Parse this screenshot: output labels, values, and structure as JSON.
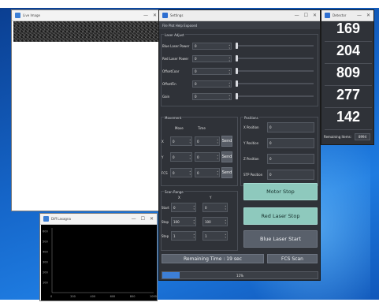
{
  "camera_window": {
    "title": "Live Image",
    "minimize": "—",
    "close": "✕"
  },
  "main_window": {
    "title": "Settings",
    "minimize": "—",
    "maximize": "☐",
    "close": "✕",
    "menu": "File   Plot   Help   Exposed",
    "laser_adjust": {
      "title": "Laser Adjust",
      "rows": [
        {
          "label": "Blue Laser Power",
          "value": "0"
        },
        {
          "label": "Red Laser Power",
          "value": "0"
        },
        {
          "label": "OffsetCoar",
          "value": "0"
        },
        {
          "label": "OffsetFin",
          "value": "0"
        },
        {
          "label": "Gain",
          "value": "0"
        }
      ]
    },
    "movement": {
      "title": "Movement",
      "move_header": "Move",
      "time_header": "Time",
      "rows": [
        {
          "axis": "X",
          "move": "0",
          "time": "0",
          "send": "Send"
        },
        {
          "axis": "Y",
          "move": "0",
          "time": "0",
          "send": "Send"
        },
        {
          "axis": "FCS",
          "move": "0",
          "time": "0",
          "send": "Send"
        }
      ]
    },
    "positions": {
      "title": "Positions",
      "rows": [
        {
          "label": "X Position",
          "value": "0"
        },
        {
          "label": "Y Position",
          "value": "0"
        },
        {
          "label": "Z Position",
          "value": "0"
        },
        {
          "label": "STP Position",
          "value": "0"
        }
      ]
    },
    "scan_range": {
      "title": "Scan Range",
      "x_header": "X",
      "y_header": "Y",
      "rows": [
        {
          "label": "Start",
          "x": "0",
          "y": "0"
        },
        {
          "label": "Stop",
          "x": "100",
          "y": "100"
        },
        {
          "label": "Step",
          "x": "1",
          "y": "1"
        }
      ]
    },
    "buttons": {
      "motor_stop": "Motor Stop",
      "red_laser_stop": "Red Laser Stop",
      "blue_laser_start": "Blue Laser Start"
    },
    "remaining_time": "Remaining Time : 19 sec",
    "fcs_scan": "FCS Scan",
    "progress": {
      "text": "11%",
      "fraction": 0.11
    }
  },
  "counter_window": {
    "title": "Detector",
    "counts": [
      "169",
      "204",
      "809",
      "277",
      "142"
    ],
    "remaining_label": "Remaining Items:",
    "remaining_value": "8994"
  },
  "graph_window": {
    "title": "Diff Lasagna",
    "minimize": "—",
    "maximize": "☐",
    "close": "✕",
    "y_ticks": [
      "100",
      "200",
      "300",
      "400",
      "500",
      "600"
    ],
    "x_ticks": [
      "0",
      "200",
      "400",
      "600",
      "800",
      "1000"
    ]
  },
  "colors": {
    "accent_teal": "#8ec9bd",
    "panel": "#2f3238",
    "progress": "#3d7fd6"
  }
}
